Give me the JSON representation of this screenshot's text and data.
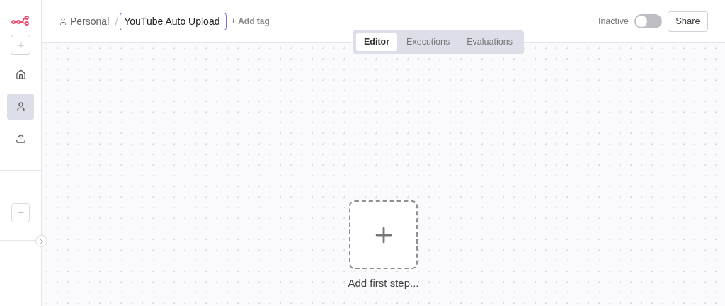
{
  "sidebar": {
    "items": [
      {
        "kind": "home",
        "selected": false
      },
      {
        "kind": "person",
        "selected": true
      },
      {
        "kind": "upload",
        "selected": false
      }
    ]
  },
  "breadcrumb": {
    "project": "Personal",
    "separator": "/"
  },
  "workflow_name": {
    "value": "YouTube Auto Upload"
  },
  "add_tag": "+ Add tag",
  "tabs": [
    {
      "label": "Editor",
      "selected": true
    },
    {
      "label": "Executions",
      "selected": false
    },
    {
      "label": "Evaluations",
      "selected": false
    }
  ],
  "activation": {
    "label": "Inactive",
    "on": false
  },
  "share_button": "Share",
  "canvas": {
    "add_step_label": "Add first step..."
  }
}
